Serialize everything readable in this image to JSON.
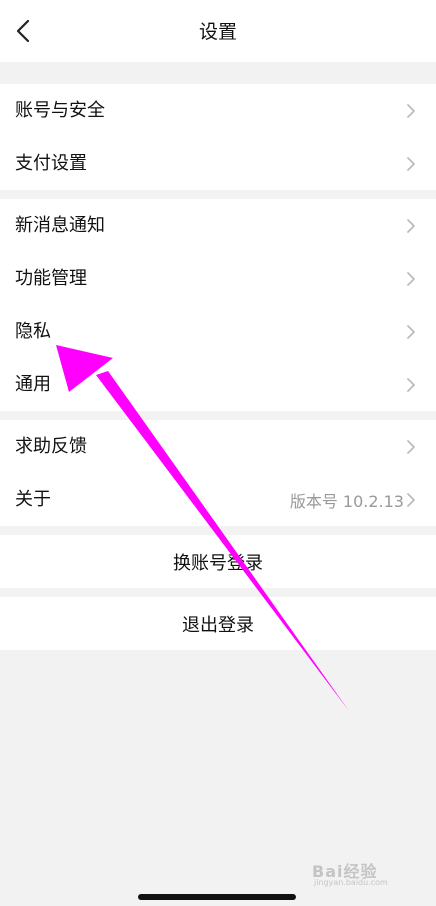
{
  "header": {
    "title": "设置"
  },
  "groups": [
    {
      "items": [
        {
          "label": "账号与安全"
        },
        {
          "label": "支付设置"
        }
      ]
    },
    {
      "items": [
        {
          "label": "新消息通知"
        },
        {
          "label": "功能管理"
        },
        {
          "label": "隐私"
        },
        {
          "label": "通用"
        }
      ]
    },
    {
      "items": [
        {
          "label": "求助反馈"
        },
        {
          "label": "关于",
          "value": "版本号 10.2.13"
        }
      ]
    }
  ],
  "actions": {
    "switch_account": "换账号登录",
    "logout": "退出登录"
  },
  "annotation": {
    "arrow_color": "#ff00ff"
  },
  "watermark": {
    "brand": "Bai经验",
    "sub": "jingyan.baidu.com"
  },
  "icons": {
    "back": "chevron-left-icon",
    "row": "chevron-right-icon"
  }
}
